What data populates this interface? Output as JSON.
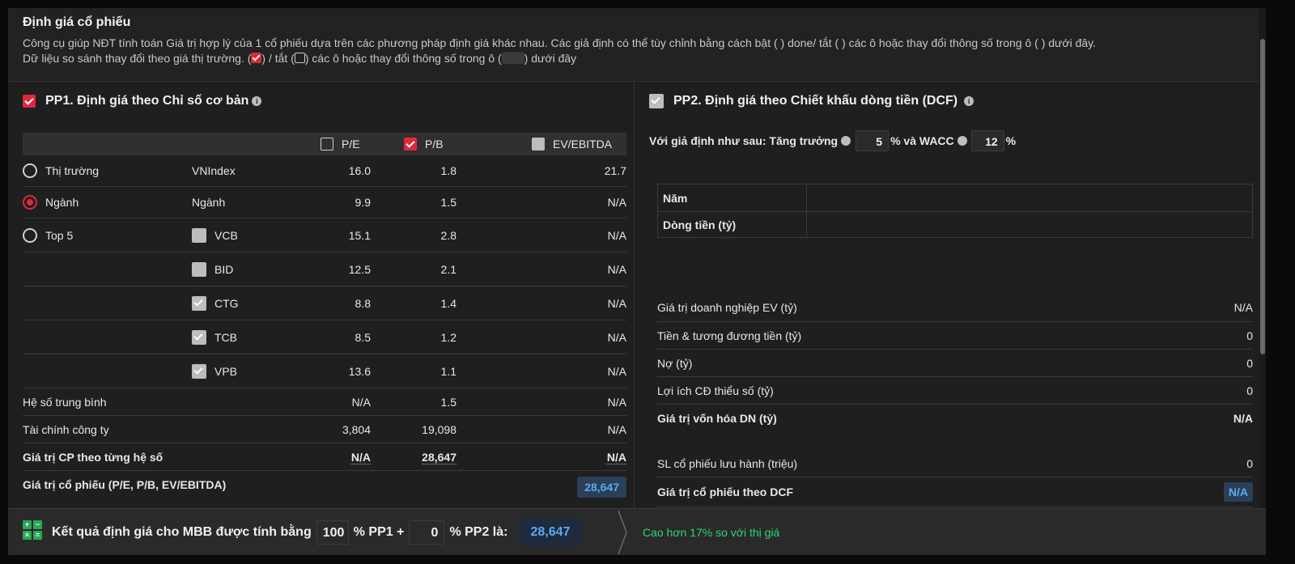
{
  "header": {
    "title": "Định giá cổ phiếu",
    "desc_line1": "Công cụ giúp NĐT tính toán Giá trị hợp lý của 1 cổ phiếu dựa trên các phương pháp định giá khác nhau. Các giả định có thể tùy chỉnh bằng cách bật ( ) done/ tắt ( ) các ô hoặc thay đổi thông số trong ô ( ) dưới đây.",
    "desc_line2_a": "Dữ liệu so sánh thay đổi theo giá thị trường. (",
    "desc_line2_b": ") / tắt (",
    "desc_line2_c": ") các ô hoặc thay đổi thông số trong ô (",
    "desc_line2_d": ") dưới đây"
  },
  "pp1": {
    "title": "PP1. Định giá theo Chỉ số cơ bản",
    "columns": [
      "P/E",
      "P/B",
      "EV/EBITDA"
    ],
    "groups": [
      {
        "radio": "Thị trường",
        "name": "VNIndex",
        "pe": "16.0",
        "pb": "1.8",
        "ev": "21.7"
      },
      {
        "radio": "Ngành",
        "name": "Ngành",
        "pe": "9.9",
        "pb": "1.5",
        "ev": "N/A"
      },
      {
        "radio": "Top 5",
        "name": "VCB",
        "pe": "15.1",
        "pb": "2.8",
        "ev": "N/A"
      }
    ],
    "peers": [
      {
        "name": "BID",
        "pe": "12.5",
        "pb": "2.1",
        "ev": "N/A"
      },
      {
        "name": "CTG",
        "pe": "8.8",
        "pb": "1.4",
        "ev": "N/A"
      },
      {
        "name": "TCB",
        "pe": "8.5",
        "pb": "1.2",
        "ev": "N/A"
      },
      {
        "name": "VPB",
        "pe": "13.6",
        "pb": "1.1",
        "ev": "N/A"
      }
    ],
    "avg": {
      "label": "Hệ số trung bình",
      "pe": "N/A",
      "pb": "1.5",
      "ev": "N/A"
    },
    "fin": {
      "label": "Tài chính công ty",
      "pe": "3,804",
      "pb": "19,098",
      "ev": "N/A"
    },
    "value_by": {
      "label": "Giá trị CP theo từng hệ số",
      "pe": "N/A",
      "pb": "28,647",
      "ev": "N/A"
    },
    "result": {
      "label": "Giá trị cổ phiếu (P/E, P/B, EV/EBITDA)",
      "value": "28,647"
    }
  },
  "pp2": {
    "title": "PP2. Định giá theo Chiết khấu dòng tiền (DCF)",
    "assume_prefix": "Với giả định như sau: Tăng trưởng",
    "growth": "5",
    "mid": "% và WACC",
    "wacc": "12",
    "pct": "%",
    "table": {
      "year_label": "Năm",
      "cf_label": "Dòng tiền (tỷ)"
    },
    "rows": [
      {
        "label": "Giá trị doanh nghiệp EV (tỷ)",
        "value": "N/A"
      },
      {
        "label": "Tiền & tương đương tiền (tỷ)",
        "value": "0"
      },
      {
        "label": "Nợ (tỷ)",
        "value": "0"
      },
      {
        "label": "Lợi ích CĐ thiểu số (tỷ)",
        "value": "0"
      },
      {
        "label": "Giá trị vốn hóa DN (tỷ)",
        "value": "N/A"
      }
    ],
    "shares": {
      "label": "SL cổ phiếu lưu hành (triệu)",
      "value": "0"
    },
    "dcf_value": {
      "label": "Giá trị cổ phiếu theo DCF",
      "value": "N/A"
    }
  },
  "footer": {
    "text_a": "Kết quả định giá cho MBB được tính bằng",
    "pp1_weight": "100",
    "text_b": "% PP1 +",
    "pp2_weight": "0",
    "text_c": "% PP2 là:",
    "result": "28,647",
    "compare": "Cao hơn 17% so với thị giá"
  },
  "colors": {
    "accent": "#e0283c",
    "value_blue": "#5aa9f5",
    "green": "#2ed47a"
  },
  "icons": {
    "calculator": "calculator-icon",
    "info": "info-icon",
    "chevron": "chevron-right-icon"
  }
}
